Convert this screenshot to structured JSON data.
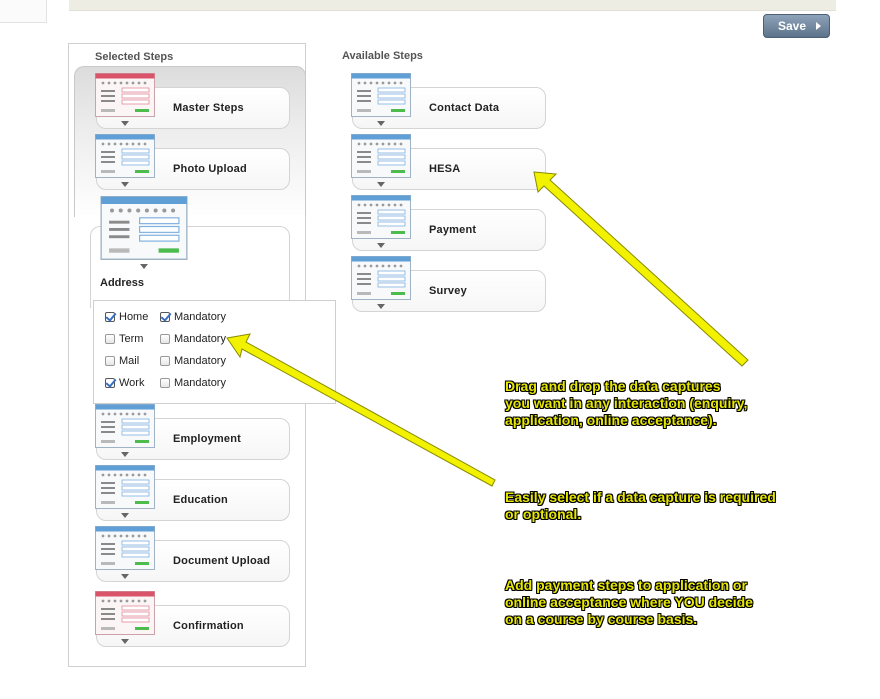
{
  "toolbar": {
    "save_label": "Save"
  },
  "selected_steps": {
    "heading": "Selected Steps",
    "items": [
      {
        "label": "Master Steps",
        "icon": "red-form-icon"
      },
      {
        "label": "Photo Upload",
        "icon": "blue-form-icon"
      },
      {
        "label": "Address",
        "icon": "blue-form-icon",
        "expanded": true
      },
      {
        "label": "Employment",
        "icon": "blue-form-icon"
      },
      {
        "label": "Education",
        "icon": "blue-form-icon"
      },
      {
        "label": "Document Upload",
        "icon": "blue-form-icon"
      },
      {
        "label": "Confirmation",
        "icon": "red-form-icon"
      }
    ]
  },
  "address_options": [
    {
      "label": "Home",
      "checked": true,
      "mandatory_label": "Mandatory",
      "mandatory": true
    },
    {
      "label": "Term",
      "checked": false,
      "mandatory_label": "Mandatory",
      "mandatory": false
    },
    {
      "label": "Mail",
      "checked": false,
      "mandatory_label": "Mandatory",
      "mandatory": false
    },
    {
      "label": "Work",
      "checked": true,
      "mandatory_label": "Mandatory",
      "mandatory": false
    }
  ],
  "available_steps": {
    "heading": "Available Steps",
    "items": [
      {
        "label": "Contact Data",
        "icon": "blue-form-icon"
      },
      {
        "label": "HESA",
        "icon": "blue-form-icon"
      },
      {
        "label": "Payment",
        "icon": "blue-form-icon"
      },
      {
        "label": "Survey",
        "icon": "blue-form-icon"
      }
    ]
  },
  "annotations": {
    "note1": [
      "Drag and drop the data captures",
      "you want in any interaction (enquiry,",
      "application, online acceptance)."
    ],
    "note2": [
      "Easily select if a data capture is required",
      "or optional."
    ],
    "note3": [
      "Add payment steps to application or",
      "online acceptance where YOU decide",
      "on a course by course basis."
    ]
  },
  "colors": {
    "annotation": "#e7e700",
    "icon_blue": "#5f9fd6",
    "icon_red": "#d9536a",
    "save_button": "#6b8299"
  }
}
